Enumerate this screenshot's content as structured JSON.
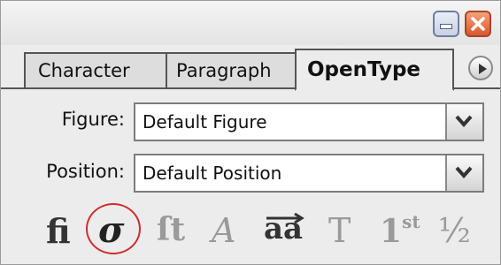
{
  "window": {
    "minimize_icon": "minimize-icon",
    "close_icon": "close-icon"
  },
  "tabs": [
    {
      "label": "Character",
      "active": false
    },
    {
      "label": "Paragraph",
      "active": false
    },
    {
      "label": "OpenType",
      "active": true
    }
  ],
  "panel_menu_icon": "panel-menu-arrow-icon",
  "figure": {
    "label": "Figure:",
    "value": "Default Figure"
  },
  "position": {
    "label": "Position:",
    "value": "Default Position"
  },
  "glyph_buttons": [
    {
      "name": "standard-ligatures",
      "glyph": "ﬁ",
      "selected": false
    },
    {
      "name": "swash",
      "glyph": "σ",
      "selected": true
    },
    {
      "name": "discretionary-ligatures",
      "glyph": "ſt",
      "selected": false
    },
    {
      "name": "titling-alternates",
      "glyph": "A",
      "selected": false
    },
    {
      "name": "contextual-alternates",
      "glyph": "aa",
      "selected": false
    },
    {
      "name": "stylistic-alternates",
      "glyph": "T",
      "selected": false
    },
    {
      "name": "ordinals",
      "glyph": "1",
      "sup": "st",
      "selected": false
    },
    {
      "name": "fractions",
      "glyph": "½",
      "selected": false
    }
  ],
  "colors": {
    "selection_ring": "#d12c2c",
    "close_button": "#d9572e",
    "minimize_button": "#c8d2e6"
  }
}
